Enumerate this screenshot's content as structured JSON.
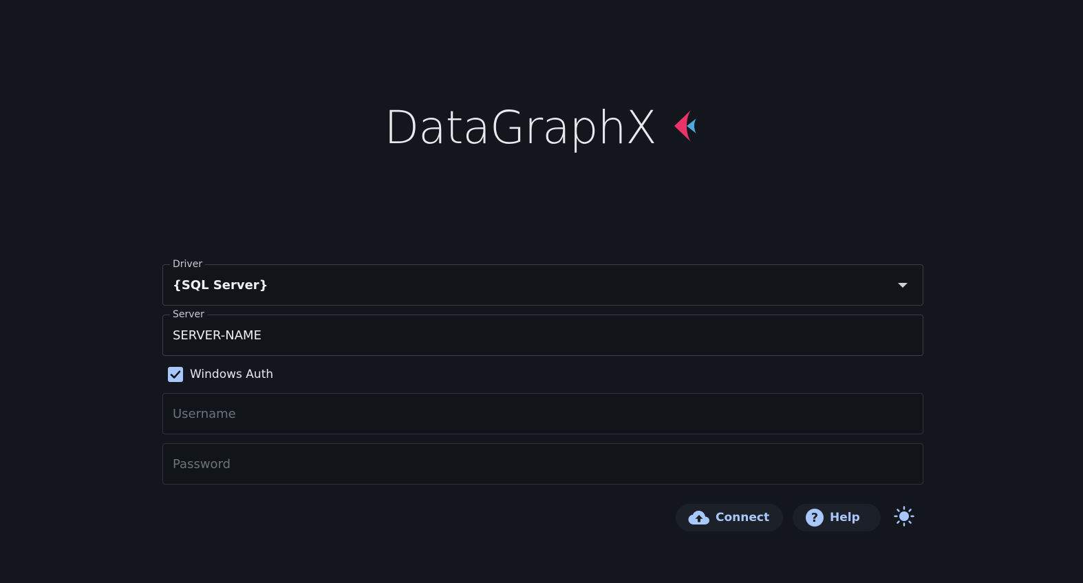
{
  "brand": {
    "title": "DataGraphX",
    "logo_icon": "datagraphx-logo-icon",
    "logo_colors": [
      "#e8336b",
      "#4ea8de"
    ]
  },
  "form": {
    "driver": {
      "label": "Driver",
      "value": "{SQL Server}"
    },
    "server": {
      "label": "Server",
      "value": "SERVER-NAME"
    },
    "windows_auth": {
      "label": "Windows Auth",
      "checked": true
    },
    "username": {
      "placeholder": "Username",
      "value": ""
    },
    "password": {
      "placeholder": "Password",
      "value": ""
    }
  },
  "actions": {
    "connect_label": "Connect",
    "connect_icon": "cloud-upload-icon",
    "help_label": "Help",
    "help_icon": "help-circle-icon",
    "theme_icon": "sun-icon"
  },
  "colors": {
    "background": "#13161c",
    "accent": "#a8c7fa",
    "button_bg": "#1c2028"
  }
}
